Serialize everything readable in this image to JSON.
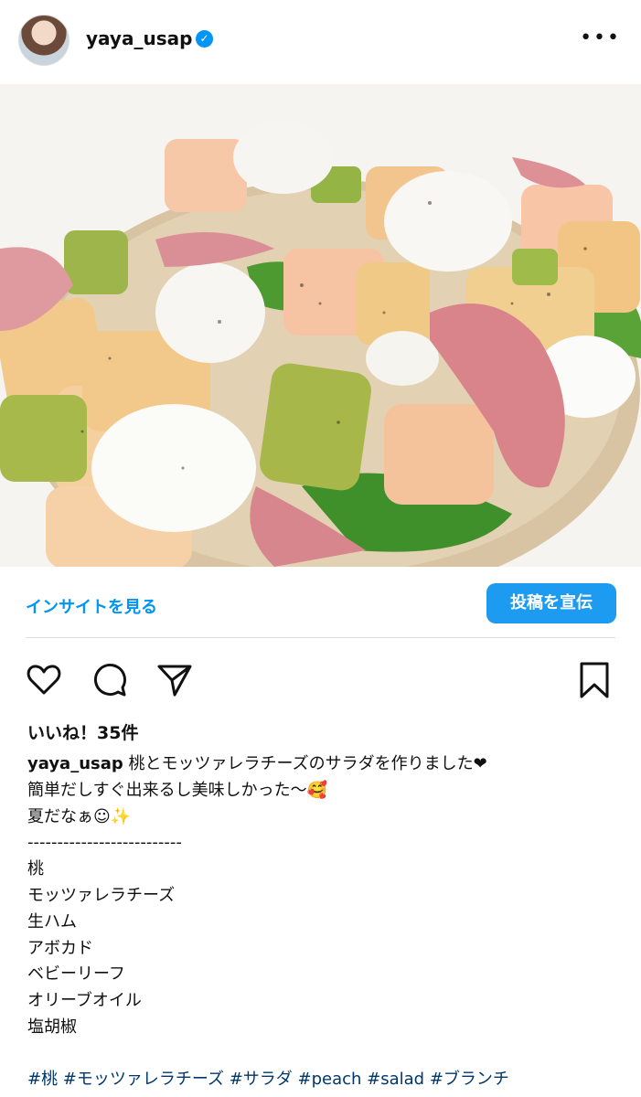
{
  "post": {
    "username": "yaya_usap",
    "verified": true,
    "more_label": "•••"
  },
  "insights": {
    "view_label": "インサイトを見る",
    "promote_label": "投稿を宣伝"
  },
  "actions": [
    "heart-icon",
    "comment-icon",
    "share-icon",
    "bookmark-icon"
  ],
  "likes": "いいね！35件",
  "caption": {
    "username": "yaya_usap",
    "text": "桃とモッツァレラチーズのサラダを作りました❤\n簡単だしすぐ出来るし美味しかった〜🥰\n夏だなぁ☺✨\n--------------------------\n桃\nモッツァレラチーズ\n生ハム\nアボカド\nベビーリーフ\nオリーブオイル\n塩胡椒"
  },
  "hashtags": "#桃 #モッツァレラチーズ #サラダ #peach #salad #ブランチ"
}
